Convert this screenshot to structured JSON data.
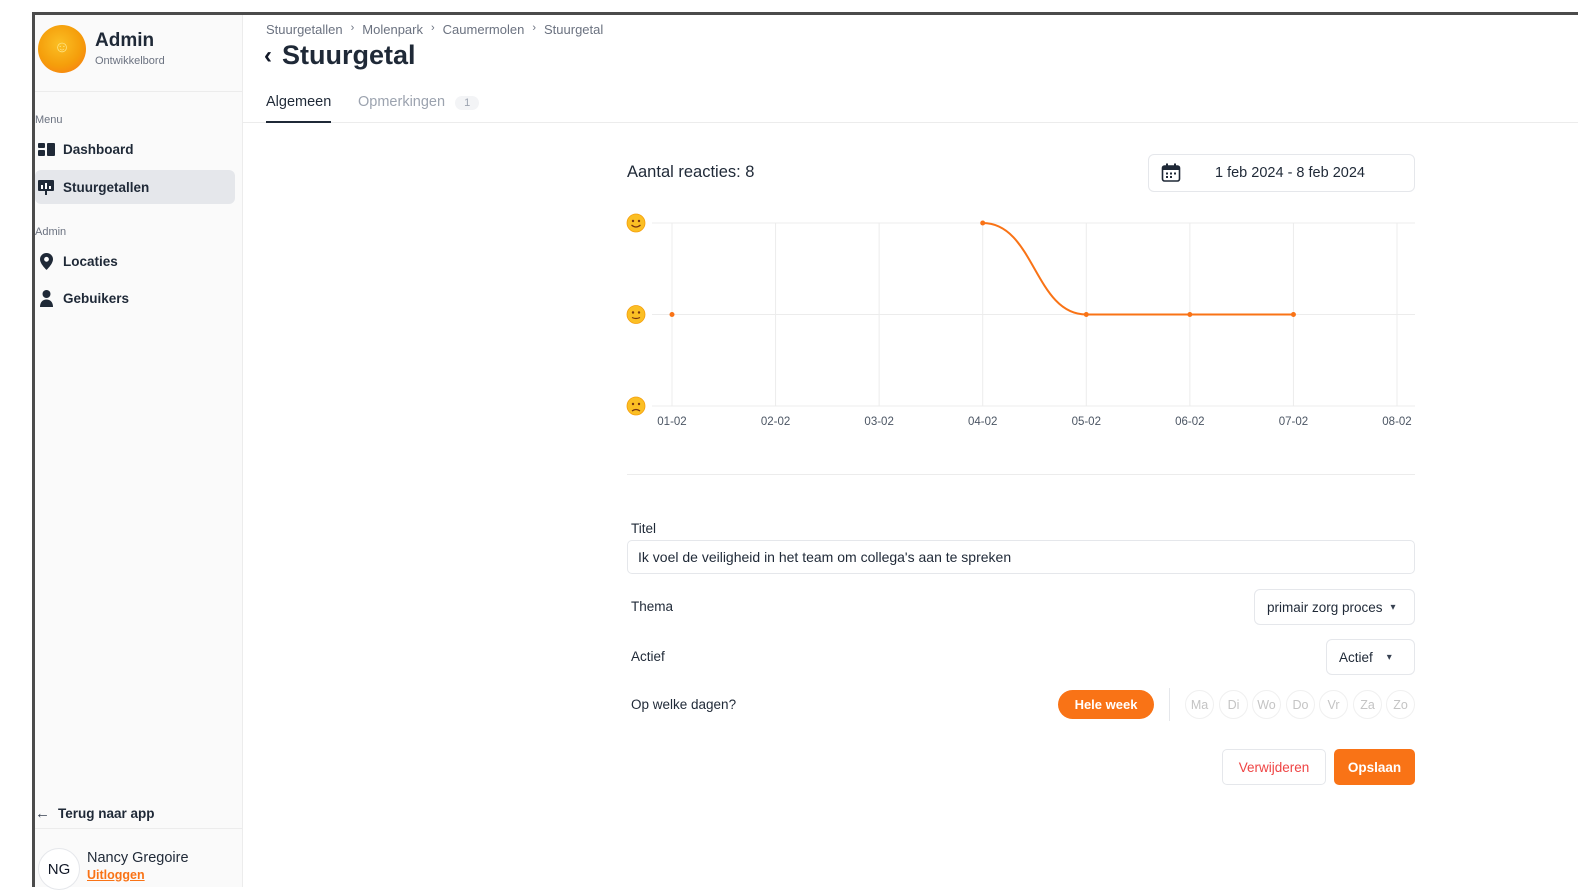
{
  "brand": {
    "name": "Admin",
    "subtitle": "Ontwikkelbord"
  },
  "sidebar": {
    "menu_label": "Menu",
    "menu_items": [
      {
        "label": "Dashboard",
        "icon": "dashboard-icon",
        "active": false
      },
      {
        "label": "Stuurgetallen",
        "icon": "chart-board-icon",
        "active": true
      }
    ],
    "admin_label": "Admin",
    "admin_items": [
      {
        "label": "Locaties",
        "icon": "location-pin-icon"
      },
      {
        "label": "Gebuikers",
        "icon": "user-icon"
      }
    ],
    "back_label": "Terug naar app",
    "user": {
      "initials": "NG",
      "name": "Nancy Gregoire",
      "logout": "Uitloggen"
    }
  },
  "breadcrumb": [
    "Stuurgetallen",
    "Molenpark",
    "Caumermolen",
    "Stuurgetal"
  ],
  "page_title": "Stuurgetal",
  "tabs": [
    {
      "label": "Algemeen",
      "active": true
    },
    {
      "label": "Opmerkingen",
      "badge": "1",
      "active": false
    }
  ],
  "card": {
    "title": "Aantal reacties: 8",
    "date_range": "1 feb 2024 - 8 feb 2024"
  },
  "chart_data": {
    "type": "line",
    "categories": [
      "01-02",
      "02-02",
      "03-02",
      "04-02",
      "05-02",
      "06-02",
      "07-02",
      "08-02"
    ],
    "y_levels": [
      "happy",
      "neutral",
      "sad"
    ],
    "ylim": [
      1,
      3
    ],
    "series": [
      {
        "values": [
          2,
          null,
          null,
          3,
          2,
          2,
          2,
          null
        ]
      }
    ],
    "color": "#f97316",
    "grid": true
  },
  "form": {
    "title_label": "Titel",
    "title_value": "Ik voel de veiligheid in het team om collega's aan te spreken",
    "thema_label": "Thema",
    "thema_value": "primair zorg proces",
    "actief_label": "Actief",
    "actief_value": "Actief",
    "days_label": "Op welke dagen?",
    "whole_week": "Hele week",
    "days": [
      "Ma",
      "Di",
      "Wo",
      "Do",
      "Vr",
      "Za",
      "Zo"
    ],
    "delete_label": "Verwijderen",
    "save_label": "Opslaan"
  },
  "colors": {
    "accent": "#f97316",
    "danger": "#ef4444"
  }
}
